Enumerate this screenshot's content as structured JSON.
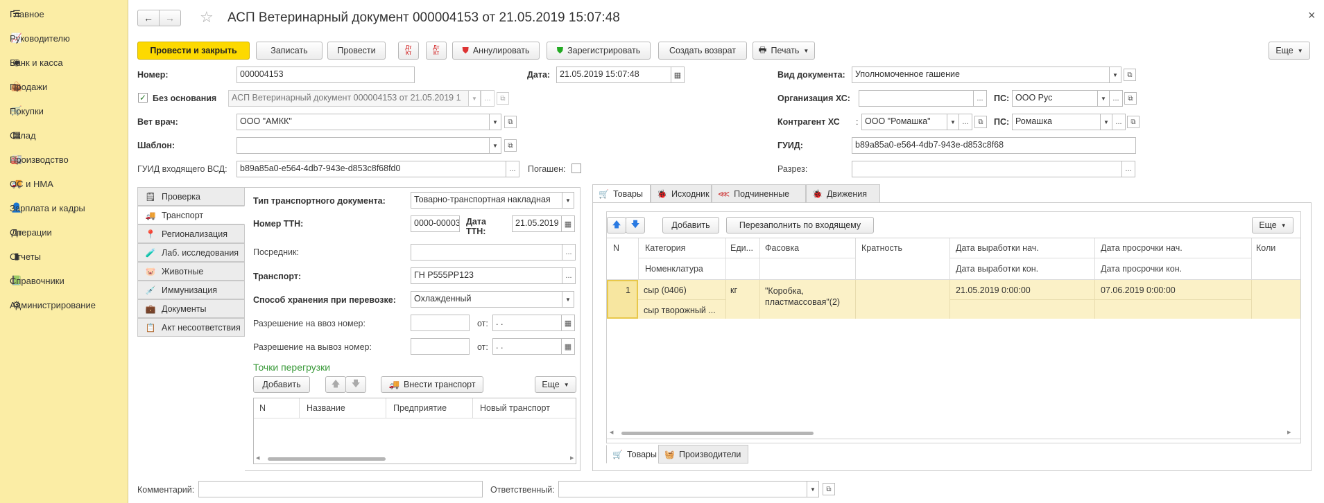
{
  "sidebar": {
    "items": [
      {
        "label": "Главное",
        "icon": "menu-icon"
      },
      {
        "label": "Руководителю",
        "icon": "chart-line-icon"
      },
      {
        "label": "Банк и касса",
        "icon": "coin-icon"
      },
      {
        "label": "Продажи",
        "icon": "bag-icon"
      },
      {
        "label": "Покупки",
        "icon": "cart-icon"
      },
      {
        "label": "Склад",
        "icon": "grid-icon"
      },
      {
        "label": "Производство",
        "icon": "factory-icon"
      },
      {
        "label": "ОС и НМА",
        "icon": "truck-icon"
      },
      {
        "label": "Зарплата и кадры",
        "icon": "person-icon"
      },
      {
        "label": "Операции",
        "icon": "dt-kt-icon"
      },
      {
        "label": "Отчеты",
        "icon": "bar-chart-icon"
      },
      {
        "label": "Справочники",
        "icon": "book-icon"
      },
      {
        "label": "Администрирование",
        "icon": "gear-icon"
      }
    ]
  },
  "header": {
    "title": "АСП Ветеринарный документ 000004153 от 21.05.2019 15:07:48",
    "back": "←",
    "forward": "→",
    "star": "☆",
    "close": "×"
  },
  "toolbar": {
    "post_close": "Провести и закрыть",
    "save": "Записать",
    "post": "Провести",
    "dtkt1": "Дт/Кт",
    "dtkt2": "Дт/Кт",
    "annul": "Аннулировать",
    "register": "Зарегистрировать",
    "create_return": "Создать возврат",
    "print": "Печать",
    "more": "Еще"
  },
  "form": {
    "number_label": "Номер:",
    "number_value": "000004153",
    "date_label": "Дата:",
    "date_value": "21.05.2019 15:07:48",
    "no_basis_label": "Без основания",
    "no_basis_value": "АСП Ветеринарный документ 000004153 от 21.05.2019 1",
    "vet_label": "Вет врач:",
    "vet_value": "ООО \"АМКК\"",
    "template_label": "Шаблон:",
    "template_value": "",
    "guid_in_label": "ГУИД входящего ВСД:",
    "guid_in_value": "b89a85a0-e564-4db7-943e-d853c8f68fd0",
    "repaid_label": "Погашен:",
    "doc_type_label": "Вид документа:",
    "doc_type_value": "Уполномоченное гашение",
    "org_label": "Организация ХС:",
    "org_value": "",
    "ps_label1": "ПС:",
    "ps_value1": "ООО Рус",
    "contr_label": "Контрагент ХС",
    "contr_colon": ":",
    "contr_value": "ООО \"Ромашка\"",
    "ps_label2": "ПС:",
    "ps_value2": "Ромашка",
    "guid_label": "ГУИД:",
    "guid_value": "b89a85a0-e564-4db7-943e-d853c8f68",
    "section_label": "Разрез:",
    "section_value": ""
  },
  "left_tabs": [
    {
      "label": "Проверка",
      "icon": "check-doc-icon"
    },
    {
      "label": "Транспорт",
      "icon": "truck-icon"
    },
    {
      "label": "Регионализация",
      "icon": "pin-icon"
    },
    {
      "label": "Лаб. исследования",
      "icon": "flask-icon"
    },
    {
      "label": "Животные",
      "icon": "pig-icon"
    },
    {
      "label": "Иммунизация",
      "icon": "syringe-icon"
    },
    {
      "label": "Документы",
      "icon": "briefcase-icon"
    },
    {
      "label": "Акт несоответствия",
      "icon": "clipboard-icon"
    }
  ],
  "transport": {
    "doc_type_label": "Тип транспортного документа:",
    "doc_type_value": "Товарно-транспортная накладная",
    "ttn_label": "Номер ТТН:",
    "ttn_value": "0000-00003",
    "ttn_date_label1": "Дата",
    "ttn_date_label2": "ТТН:",
    "ttn_date_value": "21.05.2019",
    "middleman_label": "Посредник:",
    "middleman_value": "",
    "vehicle_label": "Транспорт:",
    "vehicle_value": "ГН Р555РР123",
    "storage_label": "Способ хранения при перевозке:",
    "storage_value": "Охлажденный",
    "import_label": "Разрешение на ввоз номер:",
    "import_from": "от:",
    "import_date": " .  .",
    "export_label": "Разрешение на вывоз номер:",
    "export_from": "от:",
    "export_date": " .  .",
    "reload_title": "Точки перегрузки",
    "add": "Добавить",
    "add_transport": "Внести транспорт",
    "more": "Еще",
    "columns": [
      "N",
      "Название",
      "Предприятие",
      "Новый транспорт"
    ]
  },
  "right_tabs": [
    {
      "label": "Товары",
      "icon": "cart-icon"
    },
    {
      "label": "Исходник",
      "icon": "source-icon"
    },
    {
      "label": "Подчиненные",
      "icon": "share-icon"
    },
    {
      "label": "Движения",
      "icon": "movements-icon"
    }
  ],
  "goods": {
    "add": "Добавить",
    "refill": "Перезаполнить по входящему",
    "more": "Еще",
    "columns_top": [
      "N",
      "Категория",
      "Еди...",
      "Фасовка",
      "Кратность",
      "Дата выработки нач.",
      "Дата просрочки нач.",
      "Коли"
    ],
    "columns_bottom": [
      "Номенклатура",
      "Дата выработки кон.",
      "Дата просрочки кон."
    ],
    "rows": [
      {
        "n": "1",
        "category": "сыр (0406)",
        "nomenclature": "сыр творожный ...",
        "unit": "кг",
        "packing": "\"Коробка, пластмассовая\"(2)",
        "ratio": "",
        "prod_start": "21.05.2019 0:00:00",
        "exp_start": "07.06.2019 0:00:00"
      }
    ]
  },
  "bottom_tabs": [
    {
      "label": "Товары",
      "icon": "cart-icon"
    },
    {
      "label": "Производители",
      "icon": "basket-icon"
    }
  ],
  "footer": {
    "comment_label": "Комментарий:",
    "comment_value": "",
    "resp_label": "Ответственный:",
    "resp_value": ""
  }
}
